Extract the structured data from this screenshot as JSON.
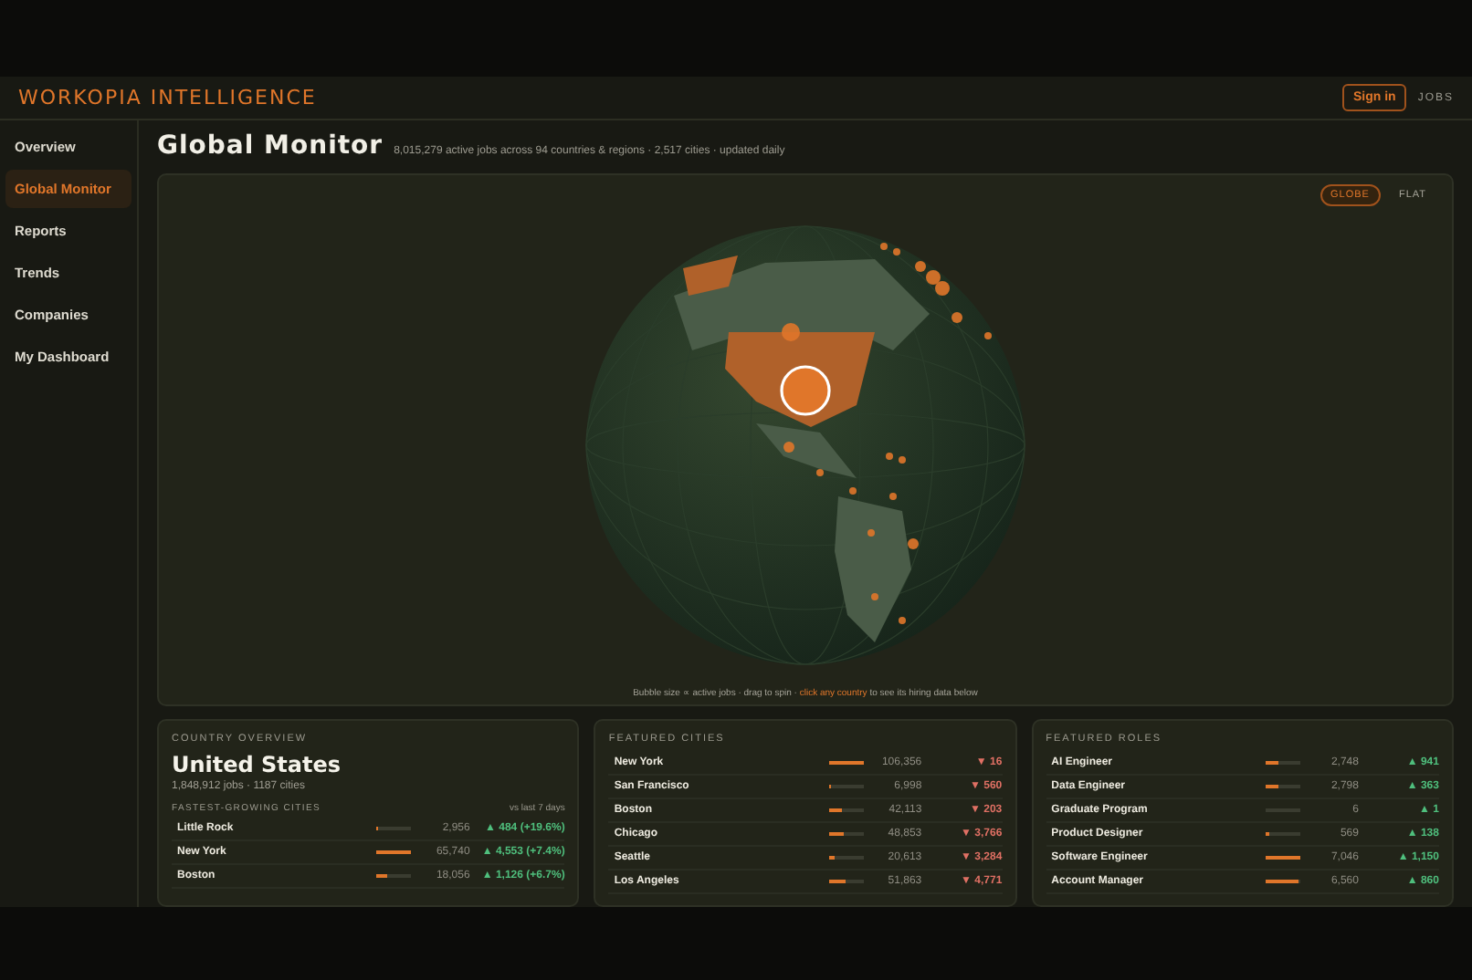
{
  "brand": "WORKOPIA INTELLIGENCE",
  "header_actions": [
    {
      "label": "Sign in",
      "kind": "outlined"
    },
    {
      "label": "JOBS",
      "kind": "plain"
    }
  ],
  "sidebar": {
    "items": [
      {
        "label": "Overview",
        "selected": false
      },
      {
        "label": "Global Monitor",
        "selected": true
      },
      {
        "label": "Reports",
        "selected": false
      },
      {
        "label": "Trends",
        "selected": false
      },
      {
        "label": "Companies",
        "selected": false
      },
      {
        "label": "My Dashboard",
        "selected": false
      }
    ]
  },
  "page": {
    "title": "Global Monitor",
    "subtitle": "8,015,279 active jobs across 94 countries & regions · 2,517 cities · updated daily"
  },
  "map": {
    "view_toggle": [
      {
        "label": "GLOBE",
        "selected": true
      },
      {
        "label": "FLAT",
        "selected": false
      }
    ],
    "hint": "Bubble size ∝ active jobs · drag to spin · ",
    "hint_link": "click any country",
    "hint_end": " to see its hiring data below"
  },
  "country_overview": {
    "heading": "COUNTRY OVERVIEW",
    "country": "United States",
    "summary": "1,848,912 jobs · 1187 cities",
    "section": "FASTEST-GROWING CITIES",
    "section_note": "vs last 7 days",
    "rows": [
      {
        "name": "Little Rock",
        "level": 0.02,
        "count": "2,956",
        "change": "▲ 484 (+19.6%)",
        "rising": true
      },
      {
        "name": "New York",
        "level": 1.0,
        "count": "65,740",
        "change": "▲ 4,553 (+7.4%)",
        "rising": true
      },
      {
        "name": "Boston",
        "level": 0.28,
        "count": "18,056",
        "change": "▲ 1,126 (+6.7%)",
        "rising": true
      }
    ]
  },
  "featured_cities": {
    "heading": "FEATURED CITIES",
    "rows": [
      {
        "name": "New York",
        "level": 1.0,
        "count": "106,356",
        "change": "▼ 16",
        "rising": false
      },
      {
        "name": "San Francisco",
        "level": 0.06,
        "count": "6,998",
        "change": "▼ 560",
        "rising": false
      },
      {
        "name": "Boston",
        "level": 0.4,
        "count": "42,113",
        "change": "▼ 203",
        "rising": false
      },
      {
        "name": "Chicago",
        "level": 0.46,
        "count": "48,853",
        "change": "▼ 3,766",
        "rising": false
      },
      {
        "name": "Seattle",
        "level": 0.2,
        "count": "20,613",
        "change": "▼ 3,284",
        "rising": false
      },
      {
        "name": "Los Angeles",
        "level": 0.48,
        "count": "51,863",
        "change": "▼ 4,771",
        "rising": false
      }
    ]
  },
  "featured_roles": {
    "heading": "FEATURED ROLES",
    "rows": [
      {
        "name": "AI Engineer",
        "level": 0.37,
        "count": "2,748",
        "change": "▲ 941",
        "rising": true
      },
      {
        "name": "Data Engineer",
        "level": 0.38,
        "count": "2,798",
        "change": "▲ 363",
        "rising": true
      },
      {
        "name": "Graduate Program",
        "level": 0,
        "count": "6",
        "change": "▲ 1",
        "rising": true
      },
      {
        "name": "Product Designer",
        "level": 0.08,
        "count": "569",
        "change": "▲ 138",
        "rising": true
      },
      {
        "name": "Software Engineer",
        "level": 1.0,
        "count": "7,046",
        "change": "▲ 1,150",
        "rising": true
      },
      {
        "name": "Account Manager",
        "level": 0.93,
        "count": "6,560",
        "change": "▲ 860",
        "rising": true
      }
    ]
  }
}
